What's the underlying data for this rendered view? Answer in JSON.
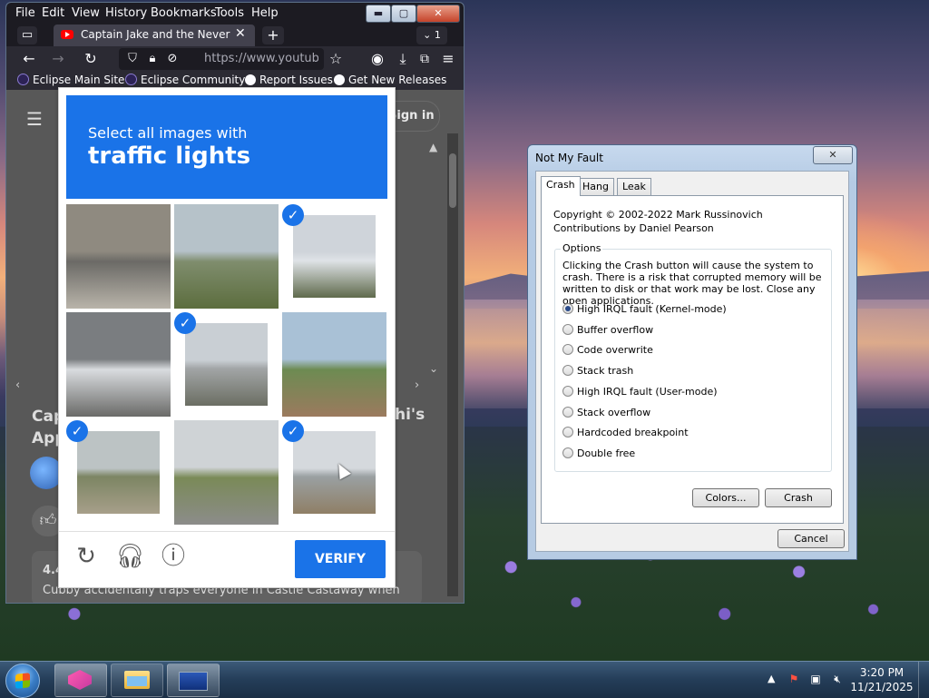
{
  "firefox": {
    "menu": [
      "File",
      "Edit",
      "View",
      "History",
      "Bookmarks",
      "Tools",
      "Help"
    ],
    "window_buttons": {
      "minimize": "▬",
      "maximize": "▢",
      "close": "✕"
    },
    "tab_title": "Captain Jake and the Never Land",
    "tab_close": "✕",
    "new_tab": "+",
    "tab_count": "1",
    "url": "https://www.youtube",
    "bookmarks": [
      "Eclipse Main Site",
      "Eclipse Community",
      "Report Issues",
      "Get New Releases"
    ]
  },
  "youtube": {
    "sign_in": "Sign in",
    "title_left": "Cap App",
    "title_right": "hi's",
    "rating": "4.4",
    "description": "Cubby accidentally traps everyone in Castle Castaway when"
  },
  "captcha": {
    "instruction": "Select all images with",
    "target": "traffic lights",
    "verify_label": "VERIFY",
    "tiles": [
      {
        "name": "tile-road-truck",
        "selected": false,
        "colors": [
          "#8f8a80",
          "#6b6a66",
          "#b9b4aa"
        ]
      },
      {
        "name": "tile-trees-field",
        "selected": false,
        "colors": [
          "#b6c2c9",
          "#7f8d6d",
          "#5c6d3e"
        ]
      },
      {
        "name": "tile-traffic-light-1",
        "selected": true,
        "colors": [
          "#cfd4da",
          "#dfe3e7",
          "#5f6a4c"
        ]
      },
      {
        "name": "tile-minivan",
        "selected": false,
        "colors": [
          "#7a7d80",
          "#d9dcdf",
          "#6a6a68"
        ]
      },
      {
        "name": "tile-traffic-light-2",
        "selected": true,
        "colors": [
          "#c9cfd4",
          "#a2a5a6",
          "#6b6e63"
        ]
      },
      {
        "name": "tile-palm-tree",
        "selected": false,
        "colors": [
          "#a9c1d6",
          "#6d8b52",
          "#9b7a5e"
        ]
      },
      {
        "name": "tile-street-trees",
        "selected": true,
        "colors": [
          "#bcc3c4",
          "#7c8563",
          "#a79f8a"
        ]
      },
      {
        "name": "tile-highway",
        "selected": false,
        "colors": [
          "#cfd3d6",
          "#7a8a58",
          "#8c8c8a"
        ]
      },
      {
        "name": "tile-traffic-light-3",
        "selected": true,
        "colors": [
          "#d5d9dd",
          "#9aa0a2",
          "#8f7f66"
        ]
      }
    ]
  },
  "nmf": {
    "title": "Not My Fault",
    "close": "✕",
    "tabs": [
      "Crash",
      "Hang",
      "Leak"
    ],
    "copyright": "Copyright © 2002-2022 Mark Russinovich",
    "contributors": "Contributions by Daniel Pearson",
    "options_label": "Options",
    "description": "Clicking the Crash button will cause the system to crash. There is a risk that corrupted memory will be written to disk or that work may be lost. Close any open applications.",
    "options": [
      "High IRQL fault (Kernel-mode)",
      "Buffer overflow",
      "Code overwrite",
      "Stack trash",
      "High IRQL fault (User-mode)",
      "Stack overflow",
      "Hardcoded breakpoint",
      "Double free"
    ],
    "selected": 0,
    "colors_button": "Colors...",
    "crash_button": "Crash",
    "cancel_button": "Cancel"
  },
  "taskbar": {
    "time": "3:20 PM",
    "date": "11/21/2025"
  },
  "colors": {
    "captcha_blue": "#1a73e8",
    "firefox_dark": "#1c1b22"
  }
}
